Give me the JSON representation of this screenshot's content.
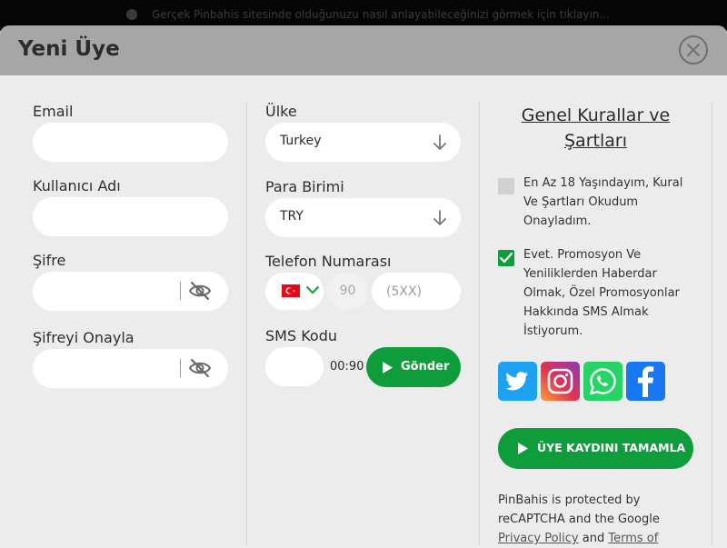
{
  "topbar": {
    "notice": "Gerçek Pinbahis sitesinde olduğunuzu nasıl anlayabileceğinizi görmek için tıklayın..."
  },
  "header": {
    "title": "Yeni Üye"
  },
  "form": {
    "email_label": "Email",
    "email_value": "",
    "username_label": "Kullanıcı Adı",
    "username_value": "",
    "password_label": "Şifre",
    "password_value": "",
    "confirm_password_label": "Şifreyi Onayla",
    "confirm_password_value": "",
    "country_label": "Ülke",
    "country_value": "Turkey",
    "currency_label": "Para Birimi",
    "currency_value": "TRY",
    "phone_label": "Telefon Numarası",
    "phone_code": "90",
    "phone_placeholder": "(5XX)",
    "sms_label": "SMS Kodu",
    "sms_value": "",
    "timer": "00:90",
    "send_label": "Gönder"
  },
  "rules": {
    "title": "Genel Kurallar ve Şartları",
    "age_consent": "En Az 18 Yaşındayım, Kural Ve Şartları Okudum Onayladım.",
    "age_consent_checked": false,
    "promo_consent": "Evet. Promosyon Ve Yeniliklerden Haberdar Olmak, Özel Promosyonlar Hakkında SMS Almak İstiyorum.",
    "promo_consent_checked": true
  },
  "social": {
    "icons": [
      "twitter-icon",
      "instagram-icon",
      "whatsapp-icon",
      "facebook-icon"
    ]
  },
  "complete_label": "ÜYE KAYDINI TAMAMLA",
  "recaptcha": {
    "text_1": "PinBahis is protected by reCAPTCHA and the Google",
    "privacy_link": "Privacy Policy",
    "and": "and",
    "terms_link": "Terms of"
  },
  "colors": {
    "accent_green": "#0f9d3c",
    "header_gray": "#a6a6a6",
    "background": "#ececec"
  }
}
